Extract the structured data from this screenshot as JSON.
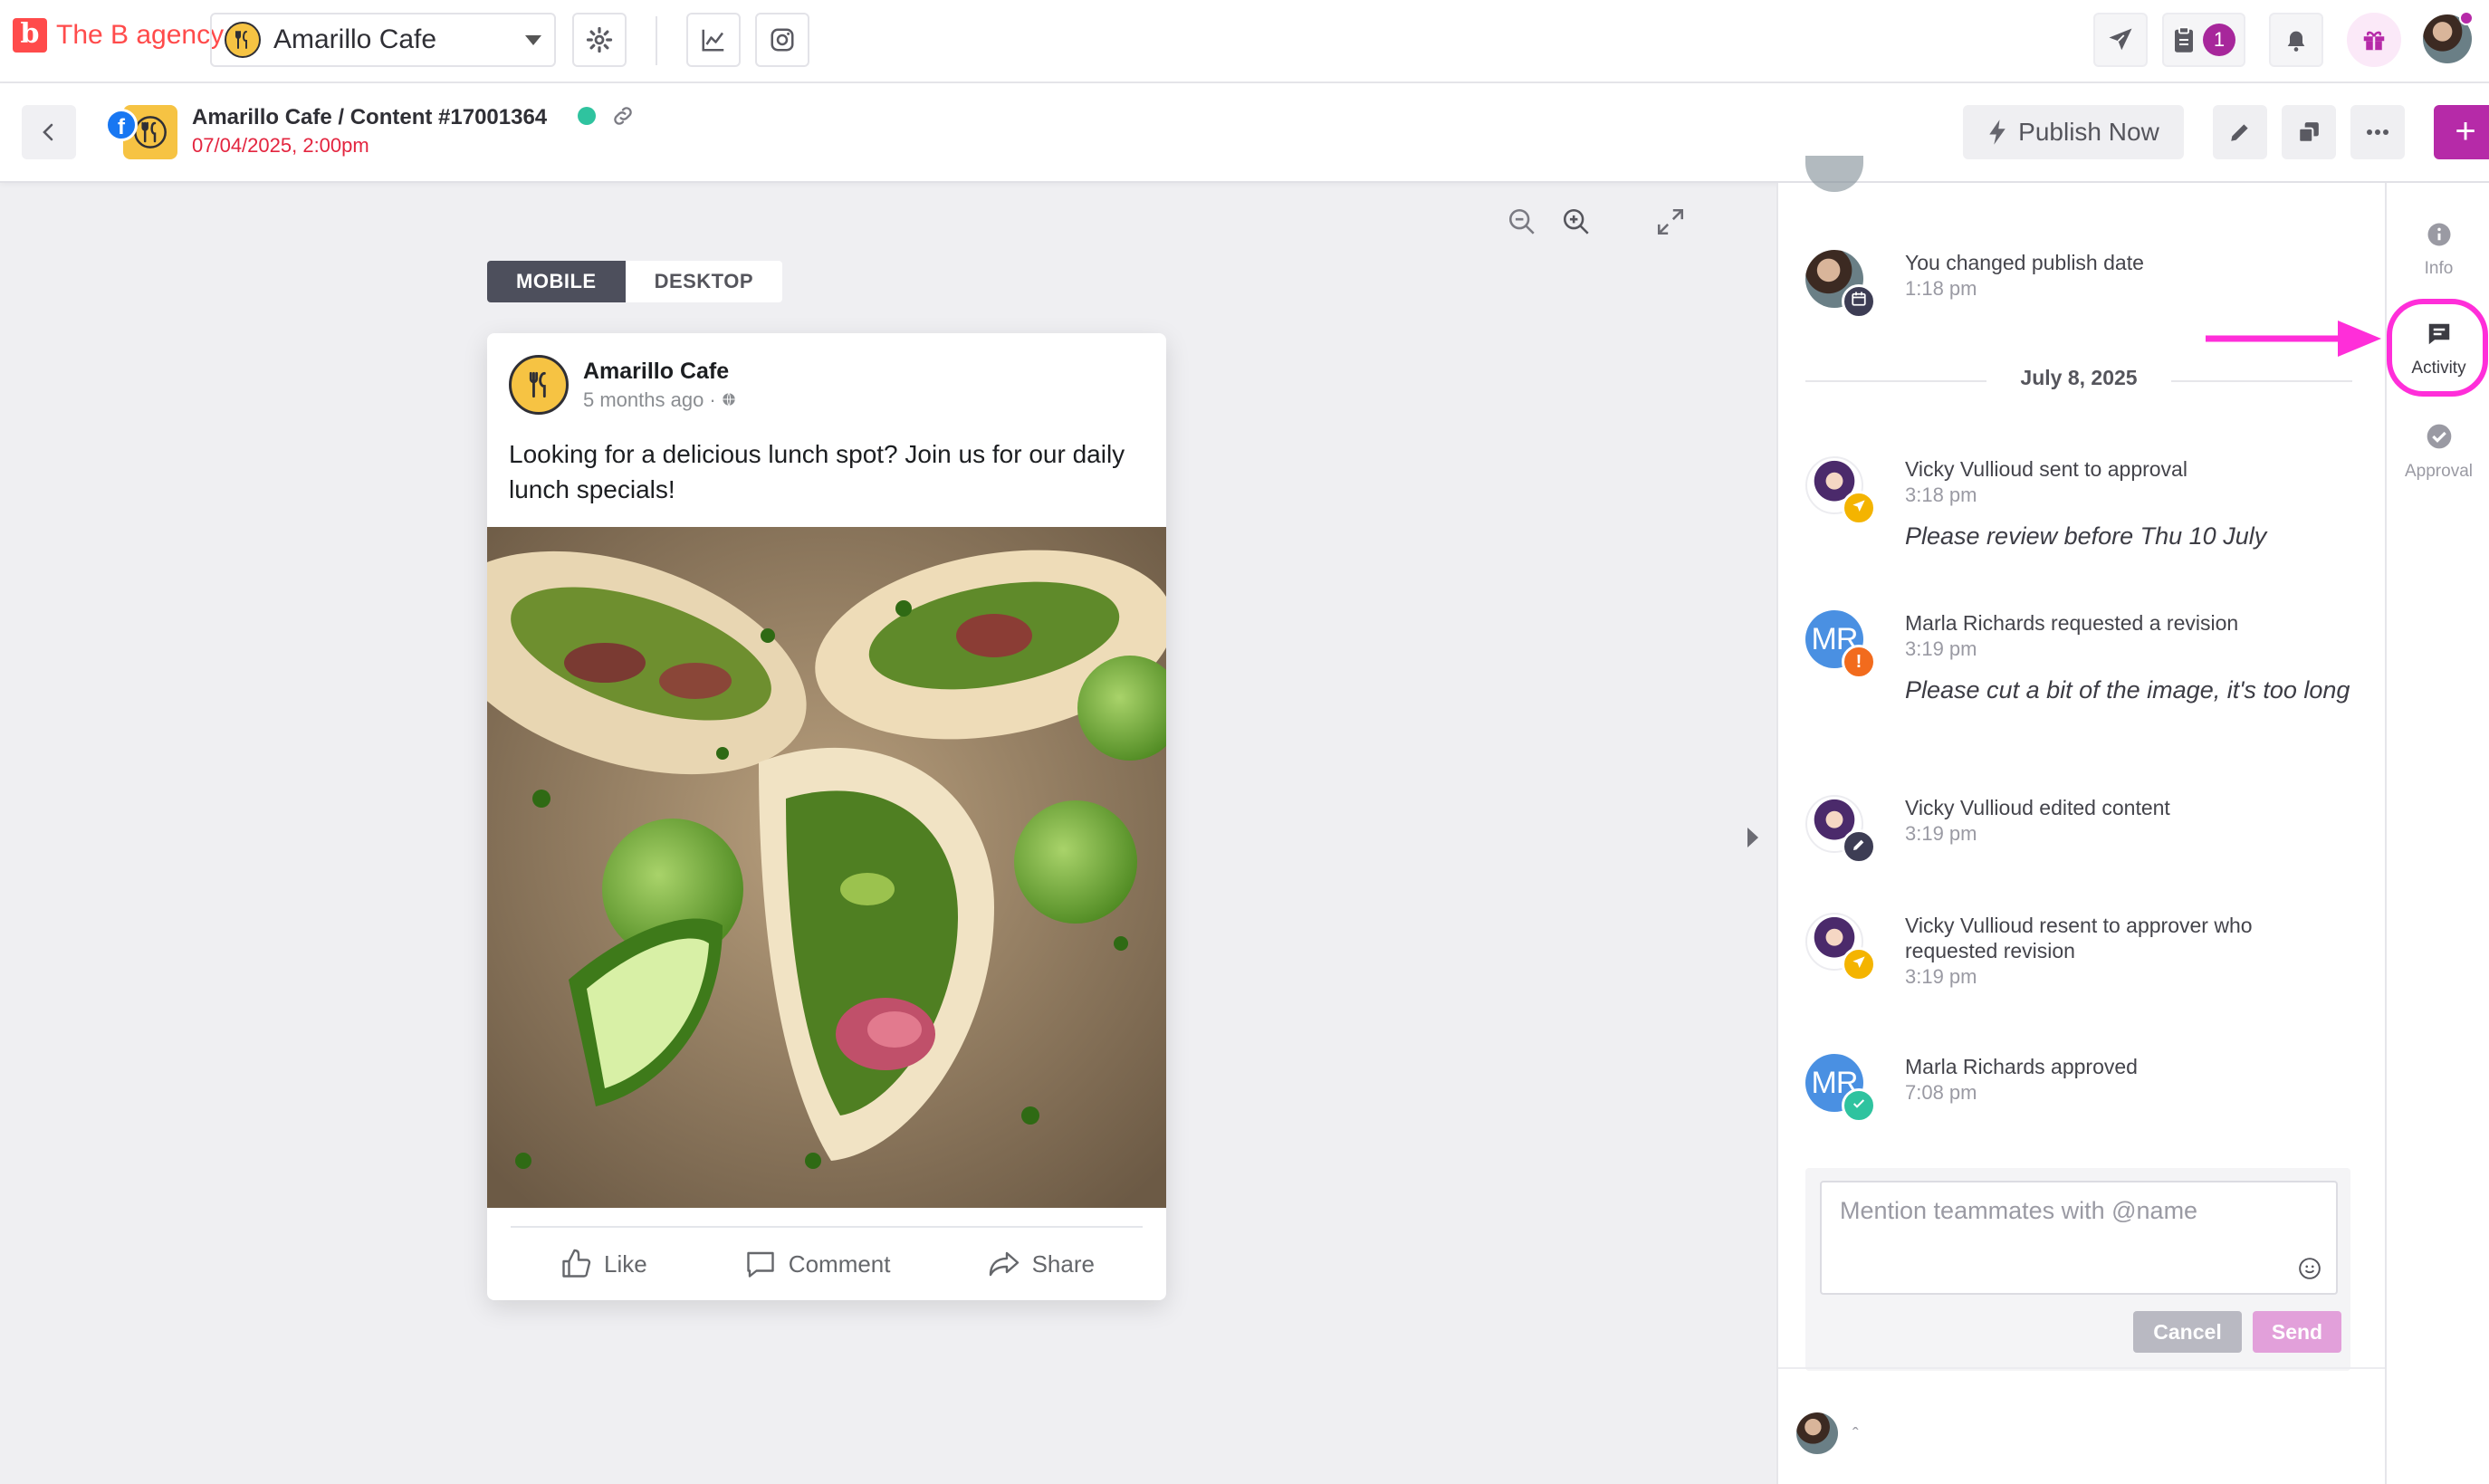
{
  "app": {
    "brand_name": "The B agency",
    "brand_letter": "b",
    "account_name": "Amarillo Cafe",
    "notification_count": "1"
  },
  "post": {
    "title": "Amarillo Cafe / Content #17001364",
    "datetime": "07/04/2025, 2:00pm",
    "network_letter": "f",
    "publish_label": "Publish Now",
    "add_label": "+"
  },
  "preview": {
    "tab_mobile": "MOBILE",
    "tab_desktop": "DESKTOP",
    "page_name": "Amarillo Cafe",
    "time_ago": "5 months ago · ",
    "text": "Looking for a delicious lunch spot? Join us for our daily lunch specials!",
    "action_like": "Like",
    "action_comment": "Comment",
    "action_share": "Share"
  },
  "activity": {
    "items": [
      {
        "title": "You changed publish date",
        "time": "1:18 pm"
      },
      {
        "title": "Vicky Vullioud sent to approval",
        "time": "3:18 pm",
        "note": "Please review before Thu 10 July"
      },
      {
        "title": "Marla Richards requested a revision",
        "time": "3:19 pm",
        "note": "Please cut a bit of the image, it's too long",
        "initials": "MR"
      },
      {
        "title": "Vicky Vullioud edited content",
        "time": "3:19 pm"
      },
      {
        "title": "Vicky Vullioud resent to approver who requested revision",
        "time": "3:19 pm"
      },
      {
        "title": "Marla Richards approved",
        "time": "7:08 pm",
        "initials": "MR"
      }
    ],
    "date_separator": "July 8, 2025",
    "composer_placeholder": "Mention teammates with @name",
    "cancel_label": "Cancel",
    "send_label": "Send",
    "revision_mark": "!"
  },
  "rail": {
    "info": "Info",
    "activity": "Activity",
    "approval": "Approval"
  },
  "colors": {
    "brand": "#ff4b4b",
    "accent": "#b62aa8",
    "date_red": "#e3253f",
    "status_green": "#2fc39f",
    "highlight": "#ff2ed9"
  },
  "icons": {
    "brand": "b-logo-icon",
    "settings": "gear-icon",
    "analytics": "chart-icon",
    "instagram": "instagram-icon",
    "send": "paper-plane-icon",
    "tasks": "clipboard-icon",
    "notifications": "bell-icon",
    "gift": "gift-icon",
    "back": "chevron-left-icon",
    "edit": "pencil-icon",
    "duplicate": "copy-icon",
    "more": "more-icon",
    "zoom_out": "zoom-out-icon",
    "zoom_in": "zoom-in-icon",
    "expand": "expand-icon",
    "globe": "globe-icon",
    "like": "thumbs-up-icon",
    "comment": "comment-icon",
    "share": "share-icon",
    "emoji": "smiley-icon",
    "info": "info-icon",
    "activity": "chat-bubble-icon",
    "approval": "check-circle-icon"
  }
}
